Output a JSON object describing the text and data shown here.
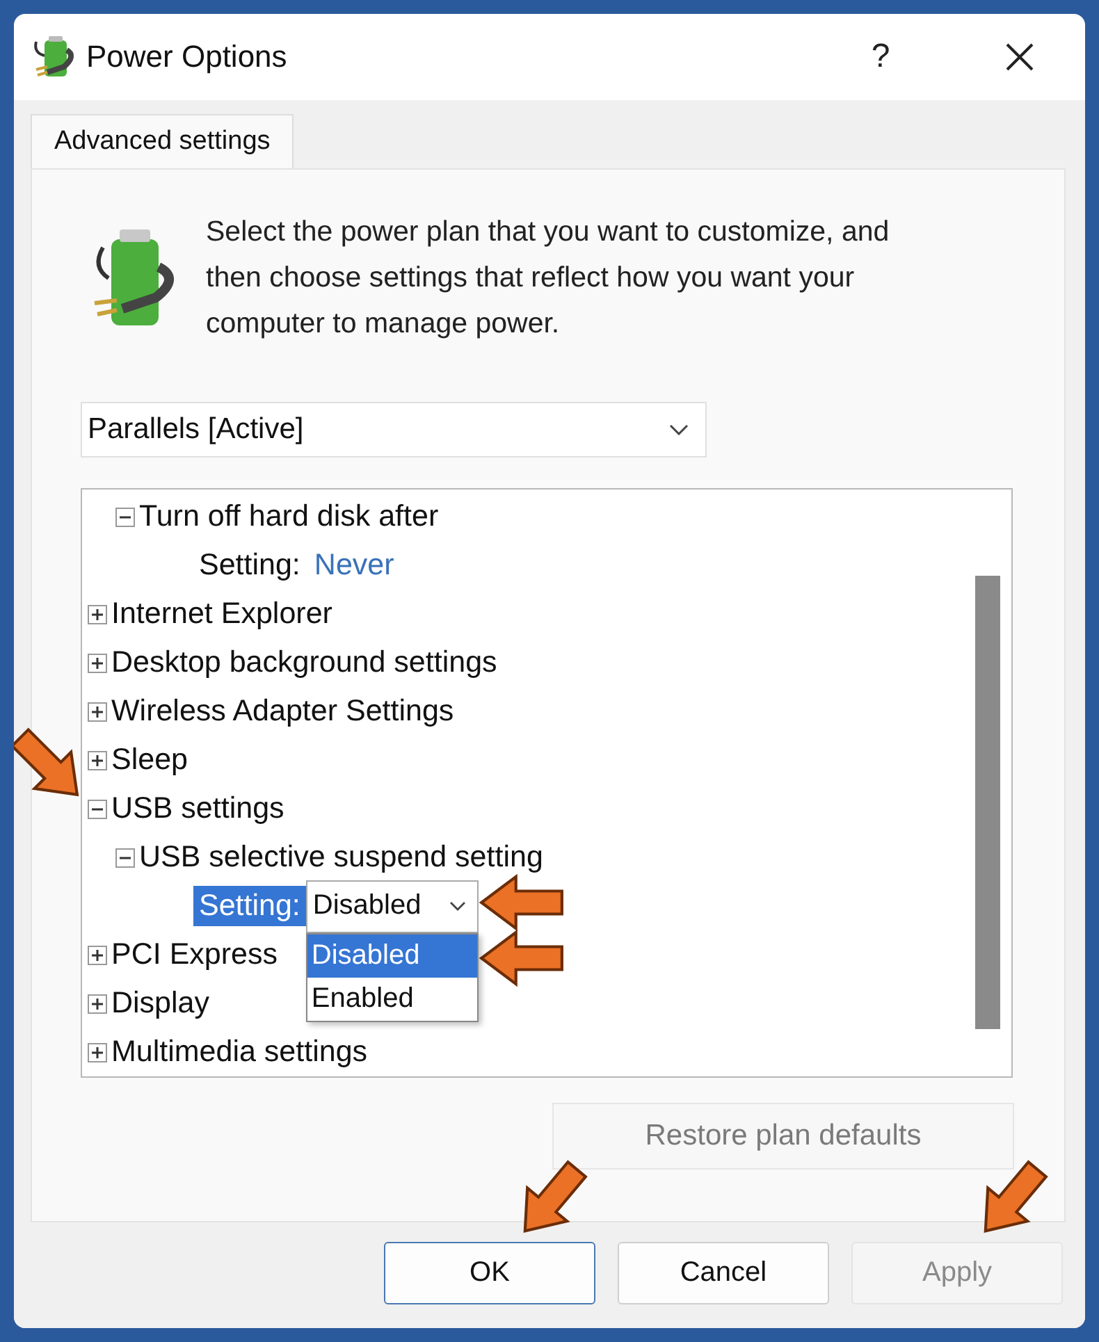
{
  "window": {
    "title": "Power Options",
    "help": "?"
  },
  "tabs": [
    {
      "label": "Advanced settings",
      "selected": true
    }
  ],
  "intro": "Select the power plan that you want to customize, and then choose settings that reflect how you want your computer to manage power.",
  "plan_dropdown": {
    "value": "Parallels [Active]"
  },
  "tree": [
    {
      "kind": "offscreen_parent",
      "children": [
        {
          "kind": "group",
          "label": "Turn off hard disk after",
          "expanded": true,
          "children": [
            {
              "kind": "setting",
              "label": "Setting:",
              "value": "Never",
              "selected": false
            }
          ]
        }
      ]
    },
    {
      "kind": "group",
      "label": "Internet Explorer",
      "expanded": false
    },
    {
      "kind": "group",
      "label": "Desktop background settings",
      "expanded": false
    },
    {
      "kind": "group",
      "label": "Wireless Adapter Settings",
      "expanded": false
    },
    {
      "kind": "group",
      "label": "Sleep",
      "expanded": false
    },
    {
      "kind": "group",
      "label": "USB settings",
      "expanded": true,
      "children": [
        {
          "kind": "group",
          "label": "USB selective suspend setting",
          "expanded": true,
          "children": [
            {
              "kind": "dropdown_setting",
              "label": "Setting:",
              "value": "Disabled",
              "selected": true,
              "open": true,
              "options": [
                {
                  "label": "Disabled",
                  "selected": true
                },
                {
                  "label": "Enabled",
                  "selected": false
                }
              ]
            }
          ]
        }
      ]
    },
    {
      "kind": "group",
      "label": "PCI Express",
      "expanded": false
    },
    {
      "kind": "group",
      "label": "Display",
      "expanded": false
    },
    {
      "kind": "group",
      "label": "Multimedia settings",
      "expanded": false
    }
  ],
  "restore_button": {
    "label": "Restore plan defaults",
    "disabled": true
  },
  "buttons": [
    {
      "label": "OK",
      "default": true,
      "disabled": false
    },
    {
      "label": "Cancel",
      "default": false,
      "disabled": false
    },
    {
      "label": "Apply",
      "default": false,
      "disabled": true
    }
  ]
}
